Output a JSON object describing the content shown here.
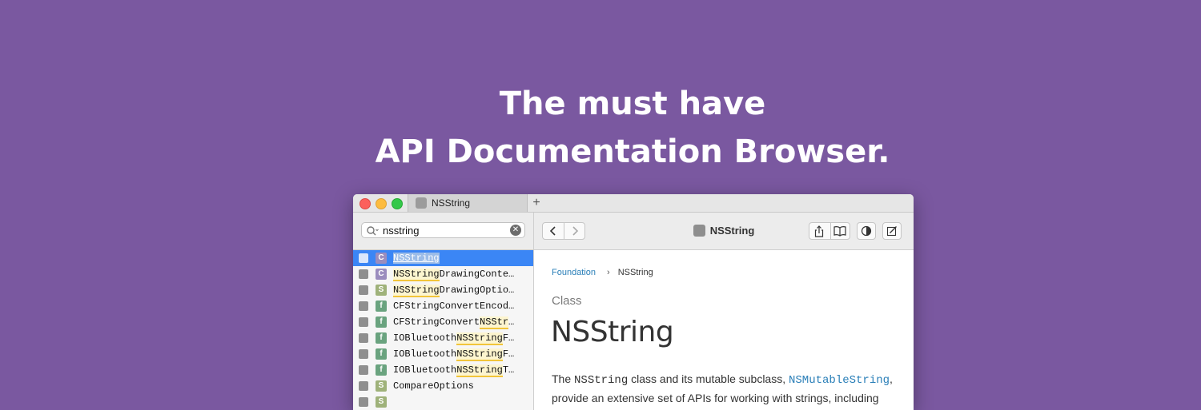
{
  "headline": {
    "line1": "The must have",
    "line2": "API Documentation Browser."
  },
  "window": {
    "tab": {
      "label": "NSString",
      "icon": "apple-icon"
    },
    "new_tab_label": "+",
    "search": {
      "value": "nsstring",
      "placeholder": ""
    },
    "toolbar": {
      "title": "NSString"
    },
    "results": [
      {
        "badge": "C",
        "badge_color": "#9b8dbe",
        "pre": "",
        "match": "NSString",
        "post": "",
        "selected": true
      },
      {
        "badge": "C",
        "badge_color": "#9b8dbe",
        "pre": "",
        "match": "NSString",
        "post": "DrawingConte…",
        "selected": false
      },
      {
        "badge": "S",
        "badge_color": "#9fb27a",
        "pre": "",
        "match": "NSString",
        "post": "DrawingOptio…",
        "selected": false
      },
      {
        "badge": "f",
        "badge_color": "#6aa37f",
        "pre": "CFStringConvertEncod…",
        "match": "",
        "post": "",
        "selected": false
      },
      {
        "badge": "f",
        "badge_color": "#6aa37f",
        "pre": "CFStringConvert",
        "match": "NSStr",
        "post": "…",
        "selected": false
      },
      {
        "badge": "f",
        "badge_color": "#6aa37f",
        "pre": "IOBluetooth",
        "match": "NSString",
        "post": "F…",
        "selected": false
      },
      {
        "badge": "f",
        "badge_color": "#6aa37f",
        "pre": "IOBluetooth",
        "match": "NSString",
        "post": "F…",
        "selected": false
      },
      {
        "badge": "f",
        "badge_color": "#6aa37f",
        "pre": "IOBluetooth",
        "match": "NSString",
        "post": "T…",
        "selected": false
      },
      {
        "badge": "S",
        "badge_color": "#9fb27a",
        "pre": "CompareOptions",
        "match": "",
        "post": "",
        "selected": false
      },
      {
        "badge": "S",
        "badge_color": "#9fb27a",
        "pre": "",
        "match": "",
        "post": "",
        "selected": false
      }
    ],
    "content": {
      "breadcrumb": {
        "parent": "Foundation",
        "separator": "›",
        "current": "NSString"
      },
      "kind": "Class",
      "title": "NSString",
      "abstract": {
        "t1": "The ",
        "c1": "NSString",
        "t2": " class and its mutable subclass, ",
        "c2": "NSMutableString",
        "t3": ",",
        "line2": "provide an extensive set of APIs for working with strings, including"
      }
    }
  },
  "colors": {
    "background": "#7a58a0",
    "selection": "#3b86f5",
    "link": "#2a7fb8",
    "highlight_underline": "#f2c53a"
  }
}
